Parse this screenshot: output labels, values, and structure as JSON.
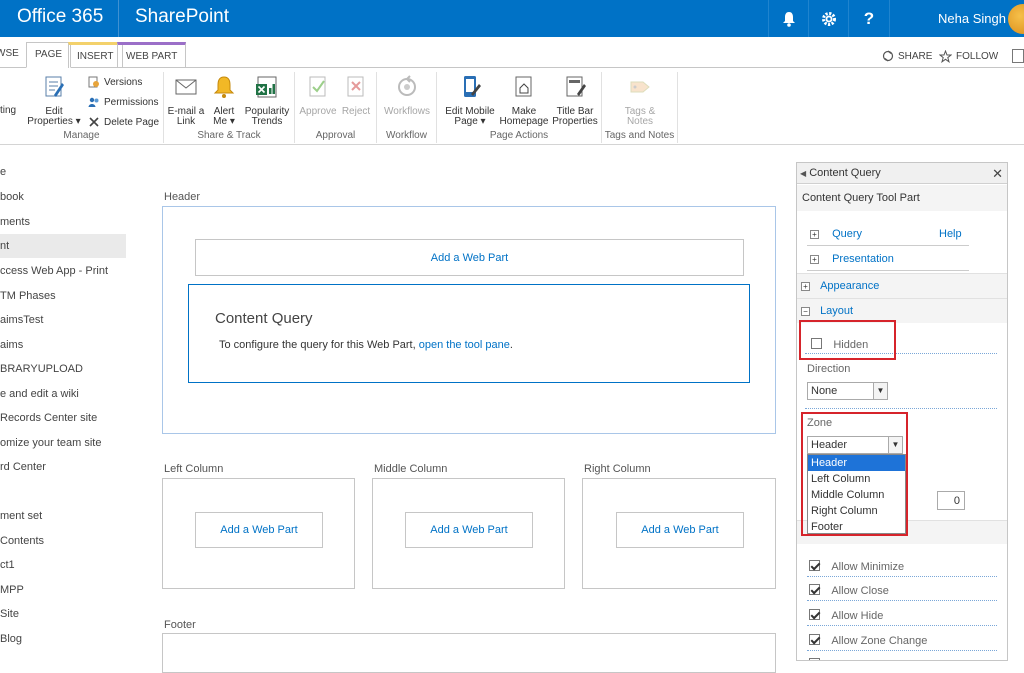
{
  "suite": {
    "app": "Office 365",
    "product": "SharePoint",
    "user": "Neha Singh",
    "icons": [
      "bell-icon",
      "gear-icon",
      "help-icon"
    ]
  },
  "ribbon": {
    "tabs": [
      {
        "label": "WSE"
      },
      {
        "label": "PAGE"
      },
      {
        "label": "INSERT"
      },
      {
        "label": "WEB PART"
      }
    ],
    "share": "SHARE",
    "follow": "FOLLOW",
    "edit_frag": "ting",
    "groups": {
      "manage": "Manage",
      "share_track": "Share & Track",
      "approval": "Approval",
      "workflow": "Workflow",
      "page_actions": "Page Actions",
      "tags_notes": "Tags and Notes"
    },
    "buttons": {
      "edit_properties_1": "Edit",
      "edit_properties_2": "Properties",
      "versions": "Versions",
      "permissions": "Permissions",
      "delete_page": "Delete Page",
      "email_1": "E-mail a",
      "email_2": "Link",
      "alert_1": "Alert",
      "alert_2": "Me",
      "popularity_1": "Popularity",
      "popularity_2": "Trends",
      "approve": "Approve",
      "reject": "Reject",
      "workflows": "Workflows",
      "edit_mobile_1": "Edit Mobile",
      "edit_mobile_2": "Page",
      "make_home_1": "Make",
      "make_home_2": "Homepage",
      "title_bar_1": "Title Bar",
      "title_bar_2": "Properties",
      "tags_1": "Tags &",
      "tags_2": "Notes"
    }
  },
  "leftnav": [
    "e",
    "book",
    "ments",
    "nt",
    "ccess Web App - Print",
    "TM Phases",
    "aimsTest",
    "aims",
    "BRARYUPLOAD",
    "e and edit a wiki",
    "Records Center site",
    "omize your team site",
    "rd Center",
    "",
    "ment set",
    "Contents",
    "ct1",
    "MPP",
    " Site",
    "Blog"
  ],
  "zones": {
    "header": "Header",
    "left": "Left Column",
    "middle": "Middle Column",
    "right": "Right Column",
    "footer": "Footer",
    "add": "Add a Web Part"
  },
  "content_query": {
    "title": "Content Query",
    "text": "To configure the query for this Web Part, ",
    "link": "open the tool pane",
    "end": "."
  },
  "toolpane": {
    "title": "Content Query",
    "subtitle": "Content Query Tool Part",
    "query": "Query",
    "help": "Help",
    "presentation": "Presentation",
    "appearance": "Appearance",
    "layout": "Layout",
    "hidden": "Hidden",
    "direction_label": "Direction",
    "direction_value": "None",
    "zone_label": "Zone",
    "zone_value": "Header",
    "zone_options": [
      "Header",
      "Left Column",
      "Middle Column",
      "Right Column",
      "Footer"
    ],
    "zone_index": "0",
    "allow_minimize": "Allow Minimize",
    "allow_close": "Allow Close",
    "allow_hide": "Allow Hide",
    "allow_zone_change": "Allow Zone Change"
  }
}
